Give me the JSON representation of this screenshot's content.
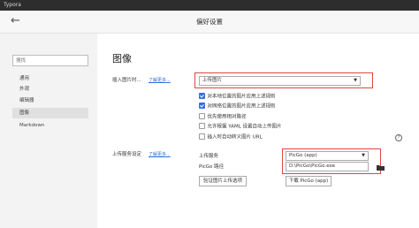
{
  "window": {
    "app_name": "Typora"
  },
  "header": {
    "title": "偏好设置",
    "back_icon": "arrow-left-icon"
  },
  "sidebar": {
    "search_placeholder": "搜找",
    "items": [
      {
        "label": "通用",
        "active": false
      },
      {
        "label": "外观",
        "active": false
      },
      {
        "label": "编辑器",
        "active": false
      },
      {
        "label": "图像",
        "active": true
      },
      {
        "label": "Markdown",
        "active": false
      }
    ]
  },
  "main": {
    "page_title": "图像",
    "insert_image": {
      "label": "插入图片时...",
      "link": "了解更多...",
      "selected_action": "上传图片",
      "options": [
        {
          "label": "对本地位置的图片应用上述规则",
          "checked": true
        },
        {
          "label": "对网络位置的图片应用上述规则",
          "checked": true
        },
        {
          "label": "优先使用相对路径",
          "checked": false
        },
        {
          "label": "允许根据 YAML 设置自动上传图片",
          "checked": false
        },
        {
          "label": "插入时自动转义图片 URL",
          "checked": false
        }
      ]
    },
    "upload_service": {
      "section_label": "上传服务设定",
      "link": "了解更多...",
      "service_label": "上传服务",
      "service_value": "PicGo (app)",
      "path_label": "PicGo 路径",
      "path_value": "D:\\PicGo\\PicGo.exe",
      "verify_button": "验证图片上传选项",
      "download_button": "下载 PicGo (app)"
    }
  },
  "colors": {
    "accent": "#3b6fd4",
    "highlight_box": "#e04545",
    "link": "#2f6fd6"
  }
}
